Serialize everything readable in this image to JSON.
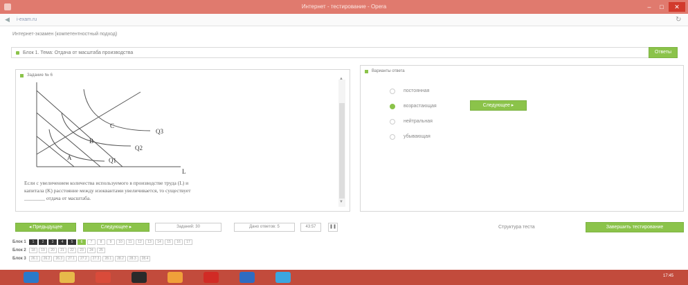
{
  "window": {
    "title": "Интернет - тестирование - Opera",
    "min": "–",
    "max": "□",
    "close": "✕"
  },
  "address": {
    "back": "◀",
    "url": "i-exam.ru",
    "refresh": "↻"
  },
  "breadcrumb": "Интернет-экзамен (компетентностный подход)",
  "block": {
    "label": "Блок 1. Тема: Отдача от масштаба производства",
    "hint_button": "Ответы"
  },
  "task": {
    "header": "Задание № 6",
    "graph": {
      "labels": [
        "A",
        "B",
        "C"
      ],
      "curves": [
        "Q1",
        "Q2",
        "Q3"
      ],
      "axis": "L"
    },
    "question_line1": "Если с увеличением количества используемого в производстве труда (L) и",
    "question_line2": "капитала (K) расстояние между изоквантами увеличивается, то существует",
    "question_line3": "________ отдача от масштаба."
  },
  "answers": {
    "header": "Варианты ответа",
    "options": [
      {
        "label": "постоянная",
        "checked": false
      },
      {
        "label": "возрастающая",
        "checked": true
      },
      {
        "label": "нейтральная",
        "checked": false
      },
      {
        "label": "убывающая",
        "checked": false
      }
    ],
    "next_inline": "Следующее ▸"
  },
  "toolbar": {
    "prev": "◂ Предыдущее",
    "next": "Следующее ▸",
    "tasks": "Заданий: 30",
    "answers": "Дано ответов: 5",
    "timer": "43:57",
    "pause": "❚❚",
    "structure": "Структура теста",
    "finish": "Завершить тестирование"
  },
  "block_rows": [
    {
      "label": "Блок 1",
      "cells": [
        {
          "t": "1",
          "s": "done"
        },
        {
          "t": "2",
          "s": "done"
        },
        {
          "t": "3",
          "s": "done"
        },
        {
          "t": "4",
          "s": "done"
        },
        {
          "t": "5",
          "s": "done"
        },
        {
          "t": "6",
          "s": "cur"
        },
        {
          "t": "7",
          "s": ""
        },
        {
          "t": "8",
          "s": ""
        },
        {
          "t": "9",
          "s": ""
        },
        {
          "t": "10",
          "s": ""
        },
        {
          "t": "11",
          "s": ""
        },
        {
          "t": "12",
          "s": ""
        },
        {
          "t": "13",
          "s": ""
        },
        {
          "t": "14",
          "s": ""
        },
        {
          "t": "15",
          "s": ""
        },
        {
          "t": "16",
          "s": ""
        },
        {
          "t": "17",
          "s": ""
        }
      ]
    },
    {
      "label": "Блок 2",
      "cells": [
        {
          "t": "18",
          "s": ""
        },
        {
          "t": "19",
          "s": ""
        },
        {
          "t": "20",
          "s": ""
        },
        {
          "t": "21",
          "s": ""
        },
        {
          "t": "22",
          "s": ""
        },
        {
          "t": "23",
          "s": ""
        },
        {
          "t": "24",
          "s": ""
        },
        {
          "t": "25",
          "s": ""
        }
      ]
    },
    {
      "label": "Блок 3",
      "cells": [
        {
          "t": "26.1",
          "s": ""
        },
        {
          "t": "26.2",
          "s": ""
        },
        {
          "t": "26.3",
          "s": ""
        },
        {
          "t": "27.1",
          "s": ""
        },
        {
          "t": "27.2",
          "s": ""
        },
        {
          "t": "27.3",
          "s": ""
        },
        {
          "t": "28.1",
          "s": ""
        },
        {
          "t": "28.2",
          "s": ""
        },
        {
          "t": "28.3",
          "s": ""
        },
        {
          "t": "28.4",
          "s": ""
        }
      ]
    }
  ],
  "taskbar": {
    "time": "17:45",
    "icons": [
      {
        "name": "ie-icon",
        "color": "#2b79c9"
      },
      {
        "name": "explorer-icon",
        "color": "#e7b94a"
      },
      {
        "name": "chrome-icon",
        "color": "#d94b3a"
      },
      {
        "name": "media-player-icon",
        "color": "#2a2a2a"
      },
      {
        "name": "paint-icon",
        "color": "#f0a03a"
      },
      {
        "name": "opera-icon",
        "color": "#d12b25"
      },
      {
        "name": "word-icon",
        "color": "#2f6cc2"
      },
      {
        "name": "skype-icon",
        "color": "#3ba6e0"
      }
    ]
  }
}
